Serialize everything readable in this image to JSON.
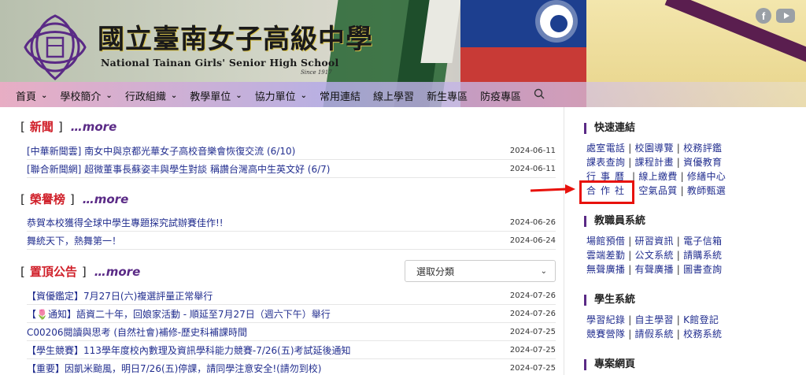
{
  "header": {
    "school_name_zh": "國立臺南女子高級中學",
    "school_name_en": "National Tainan Girls' Senior High School",
    "since": "Since 1917"
  },
  "nav": {
    "items": [
      {
        "label": "首頁",
        "has_dropdown": true
      },
      {
        "label": "學校簡介",
        "has_dropdown": true
      },
      {
        "label": "行政組織",
        "has_dropdown": true
      },
      {
        "label": "教學單位",
        "has_dropdown": true
      },
      {
        "label": "協力單位",
        "has_dropdown": true
      },
      {
        "label": "常用連結",
        "has_dropdown": false
      },
      {
        "label": "線上學習",
        "has_dropdown": false
      },
      {
        "label": "新生專區",
        "has_dropdown": false
      },
      {
        "label": "防疫專區",
        "has_dropdown": false
      }
    ]
  },
  "news": {
    "title": "新聞",
    "more": "…more",
    "items": [
      {
        "text": "[中華新聞雲] 南女中與京都光華女子高校音樂會恢復交流 (6/10)",
        "date": "2024-06-11"
      },
      {
        "text": "[聯合新聞網] 超微董事長蘇姿丰與學生對談 稱讚台灣高中生英文好 (6/7)",
        "date": "2024-06-11"
      }
    ]
  },
  "honors": {
    "title": "榮譽榜",
    "more": "…more",
    "items": [
      {
        "text": "恭賀本校獲得全球中學生專題探究試辦賽佳作!!",
        "date": "2024-06-26"
      },
      {
        "text": "舞統天下，熱舞第一！",
        "date": "2024-06-24"
      }
    ]
  },
  "pinned": {
    "title": "置頂公告",
    "more": "…more",
    "select_value": "選取分類",
    "items": [
      {
        "text": "【資優鑑定】7月27日(六)複選評量正常舉行",
        "date": "2024-07-26"
      },
      {
        "text": "【🌷通知】語資二十年，回娘家活動 - 順延至7月27日（週六下午）舉行",
        "date": "2024-07-26"
      },
      {
        "text": "C00206閱讀與思考 (自然社會)補修-歷史科補課時間",
        "date": "2024-07-25"
      },
      {
        "text": "【學生競賽】113學年度校內數理及資訊學科能力競賽-7/26(五)考試延後通知",
        "date": "2024-07-25"
      },
      {
        "text": "【重要】因凱米颱風，明日7/26(五)停課，請同學注意安全!(請勿到校)",
        "date": "2024-07-25"
      }
    ]
  },
  "sidebar": {
    "quick_links": {
      "title": "快速連結",
      "lines": [
        [
          "處室電話",
          "校園導覽",
          "校務評鑑"
        ],
        [
          "課表查詢",
          "課程計畫",
          "資優教育"
        ],
        [
          "行事曆",
          "線上繳費",
          "修繕中心"
        ],
        [
          "合作社",
          "空氣品質",
          "教師甄選"
        ]
      ]
    },
    "staff_system": {
      "title": "教職員系統",
      "lines": [
        [
          "場館預借",
          "研習資訊",
          "電子信箱"
        ],
        [
          "雲端差勤",
          "公文系統",
          "請購系統"
        ],
        [
          "無聲廣播",
          "有聲廣播",
          "圖書查詢"
        ]
      ]
    },
    "student_system": {
      "title": "學生系統",
      "lines": [
        [
          "學習紀錄",
          "自主學習",
          "K館登記"
        ],
        [
          "競賽營隊",
          "請假系統",
          "校務系統"
        ]
      ]
    },
    "project_pages": {
      "title": "專案網頁"
    }
  },
  "colors": {
    "accent": "#5a2a86",
    "heading_red": "#d0202a",
    "link_blue": "#222e8f",
    "highlight": "#e8120c"
  }
}
